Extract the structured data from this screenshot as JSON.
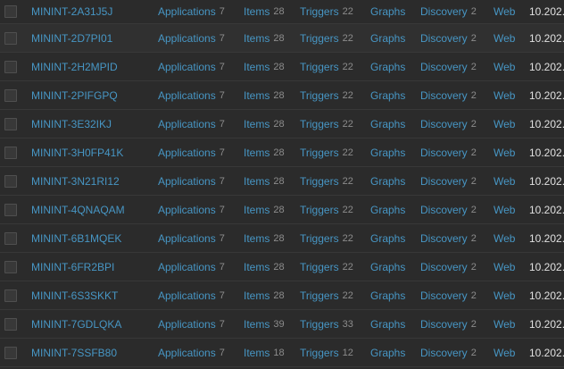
{
  "hosts": [
    {
      "name": "MININT-2A31J5J",
      "applications_label": "Applications",
      "applications_count": "7",
      "items_label": "Items",
      "items_count": "28",
      "triggers_label": "Triggers",
      "triggers_count": "22",
      "graphs_label": "Graphs",
      "discovery_label": "Discovery",
      "discovery_count": "2",
      "web_label": "Web",
      "ip": "10.202."
    },
    {
      "name": "MININT-2D7PI01",
      "applications_label": "Applications",
      "applications_count": "7",
      "items_label": "Items",
      "items_count": "28",
      "triggers_label": "Triggers",
      "triggers_count": "22",
      "graphs_label": "Graphs",
      "discovery_label": "Discovery",
      "discovery_count": "2",
      "web_label": "Web",
      "ip": "10.202."
    },
    {
      "name": "MININT-2H2MPID",
      "applications_label": "Applications",
      "applications_count": "7",
      "items_label": "Items",
      "items_count": "28",
      "triggers_label": "Triggers",
      "triggers_count": "22",
      "graphs_label": "Graphs",
      "discovery_label": "Discovery",
      "discovery_count": "2",
      "web_label": "Web",
      "ip": "10.202."
    },
    {
      "name": "MININT-2PIFGPQ",
      "applications_label": "Applications",
      "applications_count": "7",
      "items_label": "Items",
      "items_count": "28",
      "triggers_label": "Triggers",
      "triggers_count": "22",
      "graphs_label": "Graphs",
      "discovery_label": "Discovery",
      "discovery_count": "2",
      "web_label": "Web",
      "ip": "10.202."
    },
    {
      "name": "MININT-3E32IKJ",
      "applications_label": "Applications",
      "applications_count": "7",
      "items_label": "Items",
      "items_count": "28",
      "triggers_label": "Triggers",
      "triggers_count": "22",
      "graphs_label": "Graphs",
      "discovery_label": "Discovery",
      "discovery_count": "2",
      "web_label": "Web",
      "ip": "10.202."
    },
    {
      "name": "MININT-3H0FP41K",
      "applications_label": "Applications",
      "applications_count": "7",
      "items_label": "Items",
      "items_count": "28",
      "triggers_label": "Triggers",
      "triggers_count": "22",
      "graphs_label": "Graphs",
      "discovery_label": "Discovery",
      "discovery_count": "2",
      "web_label": "Web",
      "ip": "10.202."
    },
    {
      "name": "MININT-3N21RI12",
      "applications_label": "Applications",
      "applications_count": "7",
      "items_label": "Items",
      "items_count": "28",
      "triggers_label": "Triggers",
      "triggers_count": "22",
      "graphs_label": "Graphs",
      "discovery_label": "Discovery",
      "discovery_count": "2",
      "web_label": "Web",
      "ip": "10.202."
    },
    {
      "name": "MININT-4QNAQAM",
      "applications_label": "Applications",
      "applications_count": "7",
      "items_label": "Items",
      "items_count": "28",
      "triggers_label": "Triggers",
      "triggers_count": "22",
      "graphs_label": "Graphs",
      "discovery_label": "Discovery",
      "discovery_count": "2",
      "web_label": "Web",
      "ip": "10.202."
    },
    {
      "name": "MININT-6B1MQEK",
      "applications_label": "Applications",
      "applications_count": "7",
      "items_label": "Items",
      "items_count": "28",
      "triggers_label": "Triggers",
      "triggers_count": "22",
      "graphs_label": "Graphs",
      "discovery_label": "Discovery",
      "discovery_count": "2",
      "web_label": "Web",
      "ip": "10.202."
    },
    {
      "name": "MININT-6FR2BPI",
      "applications_label": "Applications",
      "applications_count": "7",
      "items_label": "Items",
      "items_count": "28",
      "triggers_label": "Triggers",
      "triggers_count": "22",
      "graphs_label": "Graphs",
      "discovery_label": "Discovery",
      "discovery_count": "2",
      "web_label": "Web",
      "ip": "10.202."
    },
    {
      "name": "MININT-6S3SKKT",
      "applications_label": "Applications",
      "applications_count": "7",
      "items_label": "Items",
      "items_count": "28",
      "triggers_label": "Triggers",
      "triggers_count": "22",
      "graphs_label": "Graphs",
      "discovery_label": "Discovery",
      "discovery_count": "2",
      "web_label": "Web",
      "ip": "10.202."
    },
    {
      "name": "MININT-7GDLQKA",
      "applications_label": "Applications",
      "applications_count": "7",
      "items_label": "Items",
      "items_count": "39",
      "triggers_label": "Triggers",
      "triggers_count": "33",
      "graphs_label": "Graphs",
      "discovery_label": "Discovery",
      "discovery_count": "2",
      "web_label": "Web",
      "ip": "10.202."
    },
    {
      "name": "MININT-7SSFB80",
      "applications_label": "Applications",
      "applications_count": "7",
      "items_label": "Items",
      "items_count": "18",
      "triggers_label": "Triggers",
      "triggers_count": "12",
      "graphs_label": "Graphs",
      "discovery_label": "Discovery",
      "discovery_count": "2",
      "web_label": "Web",
      "ip": "10.202."
    }
  ],
  "hover_row_index": 1,
  "colors": {
    "background": "#2b2b2b",
    "link": "#4796c4",
    "count": "#8c8c8c",
    "ip_text": "#e0e0e0",
    "row_border": "#383838"
  }
}
